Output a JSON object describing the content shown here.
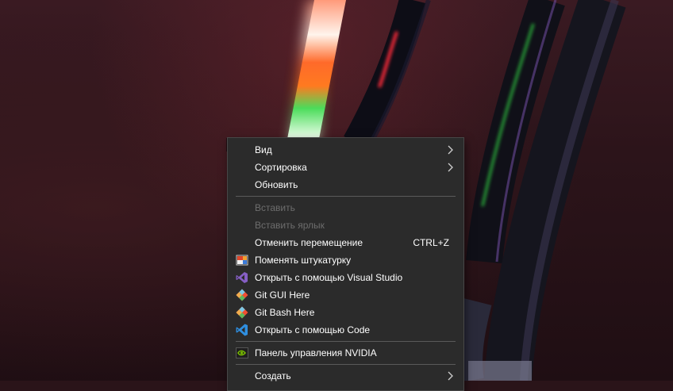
{
  "context_menu": {
    "items": [
      {
        "label": "Вид",
        "submenu": true
      },
      {
        "label": "Сортировка",
        "submenu": true
      },
      {
        "label": "Обновить"
      },
      {
        "label": "Вставить",
        "disabled": true
      },
      {
        "label": "Вставить ярлык",
        "disabled": true
      },
      {
        "label": "Отменить перемещение",
        "shortcut": "CTRL+Z"
      },
      {
        "label": "Поменять штукатурку",
        "icon": "wallpaper-icon"
      },
      {
        "label": "Открыть с помощью Visual Studio",
        "icon": "visual-studio-icon"
      },
      {
        "label": "Git GUI Here",
        "icon": "git-icon"
      },
      {
        "label": "Git Bash Here",
        "icon": "git-icon"
      },
      {
        "label": "Открыть с помощью Code",
        "icon": "vscode-icon"
      },
      {
        "label": "Панель управления NVIDIA",
        "icon": "nvidia-icon"
      },
      {
        "label": "Создать",
        "submenu": true
      }
    ]
  },
  "colors": {
    "menu_bg": "#2b2b2b",
    "menu_text": "#ffffff",
    "disabled_text": "#6d6d6d",
    "visual_studio": "#865fc5",
    "vscode": "#2f8fe0",
    "nvidia": "#76b900",
    "git": "#f14e32"
  }
}
